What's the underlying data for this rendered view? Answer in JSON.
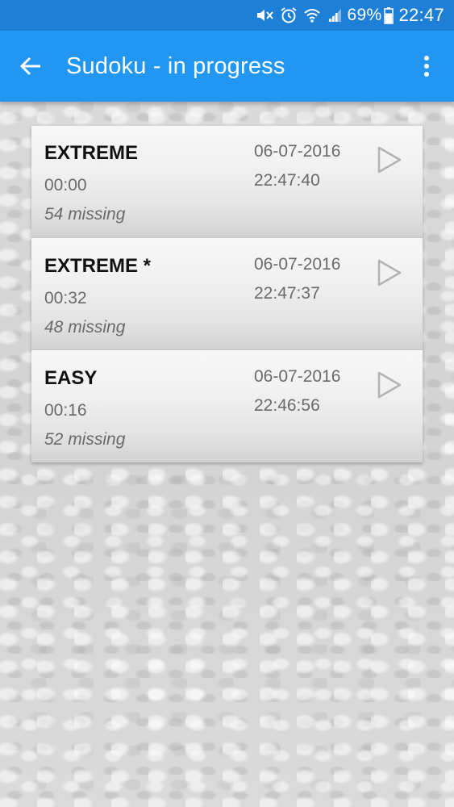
{
  "status_bar": {
    "battery_percent": "69%",
    "clock": "22:47",
    "icons": [
      "mute-icon",
      "alarm-icon",
      "wifi-icon",
      "signal-icon",
      "battery-icon"
    ]
  },
  "app_bar": {
    "title": "Sudoku - in progress",
    "back_icon": "arrow-left-icon",
    "menu_icon": "more-vertical-icon",
    "color": "#2196f3",
    "status_color": "#1e7fd6"
  },
  "games": [
    {
      "difficulty": "EXTREME",
      "elapsed": "00:00",
      "missing": "54 missing",
      "date": "06-07-2016",
      "time": "22:47:40"
    },
    {
      "difficulty": "EXTREME *",
      "elapsed": "00:32",
      "missing": "48 missing",
      "date": "06-07-2016",
      "time": "22:47:37"
    },
    {
      "difficulty": "EASY",
      "elapsed": "00:16",
      "missing": "52 missing",
      "date": "06-07-2016",
      "time": "22:46:56"
    }
  ]
}
